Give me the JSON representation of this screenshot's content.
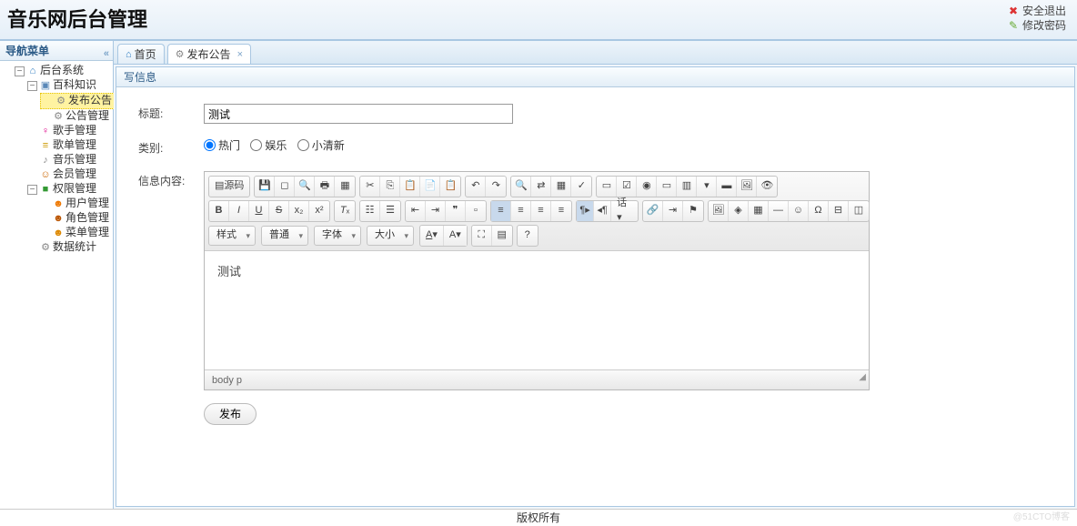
{
  "header": {
    "title": "音乐网后台管理",
    "logout": "安全退出",
    "password": "修改密码"
  },
  "sidebar": {
    "title": "导航菜单",
    "tree": {
      "root": "后台系统",
      "baike": "百科知识",
      "publish": "发布公告",
      "manage": "公告管理",
      "singer": "歌手管理",
      "playlist": "歌单管理",
      "music": "音乐管理",
      "member": "会员管理",
      "perm": "权限管理",
      "user": "用户管理",
      "role": "角色管理",
      "menu": "菜单管理",
      "stats": "数据统计"
    }
  },
  "tabs": {
    "home": "首页",
    "publish": "发布公告"
  },
  "panel": {
    "title": "写信息",
    "label_title": "标题:",
    "title_value": "测试",
    "label_category": "类别:",
    "categories": {
      "hot": "热门",
      "ent": "娱乐",
      "fresh": "小清新"
    },
    "label_content": "信息内容:",
    "editor_text": "测试",
    "source_btn": "源码",
    "dd_style": "样式",
    "dd_format": "普通",
    "dd_font": "字体",
    "dd_size": "大小",
    "status_path": "body   p",
    "publish_btn": "发布"
  },
  "footer": "版权所有",
  "watermark": "@51CTO博客"
}
